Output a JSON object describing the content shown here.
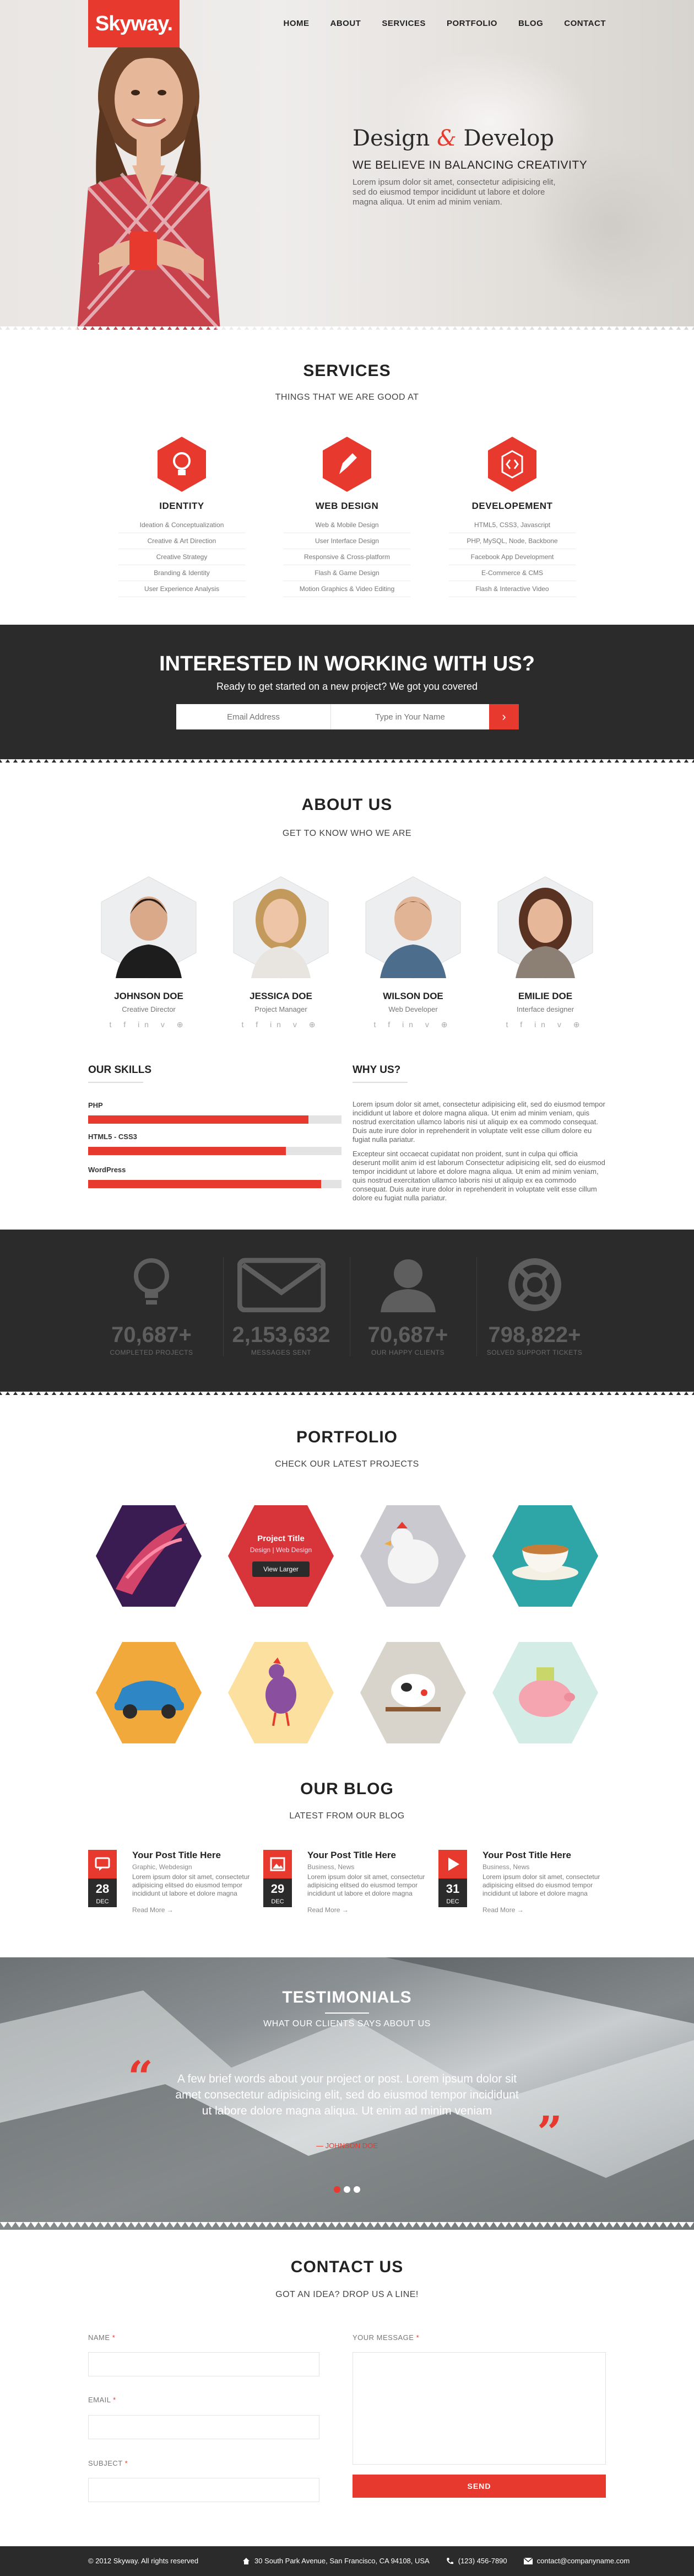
{
  "brand": {
    "logo": "Skyway.",
    "accent": "#e8392f",
    "dark": "#2b2b2b"
  },
  "nav": [
    "HOME",
    "ABOUT",
    "SERVICES",
    "PORTFOLIO",
    "BLOG",
    "CONTACT"
  ],
  "hero": {
    "title_a": "Design",
    "title_amp": "&",
    "title_b": "Develop",
    "subtitle": "WE BELIEVE IN BALANCING CREATIVITY",
    "text": "Lorem ipsum dolor sit amet, consectetur adipisicing elit, sed do eiusmod tempor incididunt ut labore et dolore magna aliqua. Ut enim ad minim veniam."
  },
  "services": {
    "title": "SERVICES",
    "subtitle": "THINGS THAT WE ARE GOOD AT",
    "items": [
      {
        "icon": "lightbulb-icon",
        "title": "IDENTITY",
        "list": [
          "Ideation & Conceptualization",
          "Creative & Art Direction",
          "Creative Strategy",
          "Branding & Identity",
          "User Experience Analysis"
        ]
      },
      {
        "icon": "pen-icon",
        "title": "WEB DESIGN",
        "list": [
          "Web & Mobile Design",
          "User Interface Design",
          "Responsive & Cross-platform",
          "Flash & Game Design",
          "Motion Graphics & Video Editing"
        ]
      },
      {
        "icon": "code-icon",
        "title": "DEVELOPEMENT",
        "list": [
          "HTML5, CSS3, Javascript",
          "PHP, MySQL, Node, Backbone",
          "Facebook App Development",
          "E-Commerce & CMS",
          "Flash & Interactive Video"
        ]
      }
    ]
  },
  "cta": {
    "title": "INTERESTED IN WORKING WITH US?",
    "subtitle": "Ready to get started on a new project? We got you covered",
    "email_placeholder": "Email Address",
    "name_placeholder": "Type in Your Name",
    "button": "›"
  },
  "about": {
    "title": "ABOUT US",
    "subtitle": "GET TO KNOW WHO WE ARE",
    "team": [
      {
        "name": "JOHNSON DOE",
        "role": "Creative Director"
      },
      {
        "name": "JESSICA DOE",
        "role": "Project Manager"
      },
      {
        "name": "WILSON DOE",
        "role": "Web Developer"
      },
      {
        "name": "EMILIE DOE",
        "role": "Interface designer"
      }
    ],
    "social": "t f in v ⊕",
    "skills_title": "OUR SKILLS",
    "skills": [
      {
        "label": "PHP",
        "value": 0.87
      },
      {
        "label": "HTML5 - CSS3",
        "value": 0.78
      },
      {
        "label": "WordPress",
        "value": 0.92
      }
    ],
    "why_title": "WHY US?",
    "why_p1": "Lorem ipsum dolor sit amet, consectetur adipisicing elit, sed do eiusmod tempor incididunt ut labore et dolore magna aliqua. Ut enim ad minim veniam, quis nostrud exercitation ullamco laboris nisi ut aliquip ex ea commodo consequat. Duis aute irure dolor in reprehenderit in voluptate velit esse cillum dolore eu fugiat nulla pariatur.",
    "why_p2": "Excepteur sint occaecat cupidatat non proident, sunt in culpa qui officia deserunt mollit anim id est laborum Consectetur adipisicing elit, sed do eiusmod tempor incididunt ut labore et dolore magna aliqua. Ut enim ad minim veniam, quis nostrud exercitation ullamco laboris nisi ut aliquip ex ea commodo consequat. Duis aute irure dolor in reprehenderit in voluptate velit esse cillum dolore eu fugiat nulla pariatur."
  },
  "stats": [
    {
      "icon": "lightbulb-icon",
      "num": "70,687+",
      "label": "COMPLETED PROJECTS"
    },
    {
      "icon": "mail-icon",
      "num": "2,153,632",
      "label": "MESSAGES SENT"
    },
    {
      "icon": "user-icon",
      "num": "70,687+",
      "label": "OUR HAPPY CLIENTS"
    },
    {
      "icon": "lifebuoy-icon",
      "num": "798,822+",
      "label": "SOLVED SUPPORT TICKETS"
    }
  ],
  "portfolio": {
    "title": "PORTFOLIO",
    "subtitle": "CHECK OUR LATEST PROJECTS",
    "hover": {
      "title": "Project Title",
      "cat": "Design | Web Design",
      "btn": "View Larger"
    },
    "items": [
      {
        "name": "abstract-art",
        "color": "#5a2a6a"
      },
      {
        "name": "project-hover",
        "color": "#d8353a"
      },
      {
        "name": "chicken-illustration",
        "color": "#c9c9cf"
      },
      {
        "name": "teacup",
        "color": "#2ea6a8"
      },
      {
        "name": "blue-car",
        "color": "#f2a93b"
      },
      {
        "name": "rooster",
        "color": "#fbe0a0"
      },
      {
        "name": "cow-character",
        "color": "#d8d4cc"
      },
      {
        "name": "piggy-bank",
        "color": "#d4ece6"
      }
    ]
  },
  "blog": {
    "title": "OUR BLOG",
    "subtitle": "LATEST FROM OUR BLOG",
    "posts": [
      {
        "icon": "chat-icon",
        "day": "28",
        "month": "DEC",
        "title": "Your Post Title Here",
        "meta": "Graphic, Webdesign",
        "text": "Lorem ipsum dolor sit amet, consectetur adipisicing elitsed do eiusmod tempor incididunt ut labore et dolore magna",
        "more": "Read More →"
      },
      {
        "icon": "image-icon",
        "day": "29",
        "month": "DEC",
        "title": "Your Post Title Here",
        "meta": "Business, News",
        "text": "Lorem ipsum dolor sit amet, consectetur adipisicing elitsed do eiusmod tempor incididunt ut labore et dolore magna",
        "more": "Read More →"
      },
      {
        "icon": "play-icon",
        "day": "31",
        "month": "DEC",
        "title": "Your Post Title Here",
        "meta": "Business, News",
        "text": "Lorem ipsum dolor sit amet, consectetur adipisicing elitsed do eiusmod tempor incididunt ut labore et dolore magna",
        "more": "Read More →"
      }
    ]
  },
  "testimonials": {
    "title": "TESTIMONIALS",
    "subtitle": "WHAT OUR CLIENTS SAYS ABOUT US",
    "quote": "A few brief words about your project or post. Lorem ipsum dolor sit amet consectetur adipisicing elit, sed do eiusmod tempor incididunt ut labore dolore magna aliqua. Ut enim ad minim veniam",
    "name": "— JOHNSON DOE"
  },
  "contact": {
    "title": "CONTACT US",
    "subtitle": "GOT AN IDEA? DROP US A LINE!",
    "name_label": "NAME",
    "email_label": "EMAIL",
    "subject_label": "SUBJECT",
    "message_label": "YOUR MESSAGE",
    "required": "*",
    "send": "SEND"
  },
  "footer": {
    "copy": "© 2012 Skyway. All rights reserved",
    "address": "30 South Park Avenue, San Francisco, CA 94108, USA",
    "phone": "(123) 456-7890",
    "email": "contact@companyname.com"
  }
}
